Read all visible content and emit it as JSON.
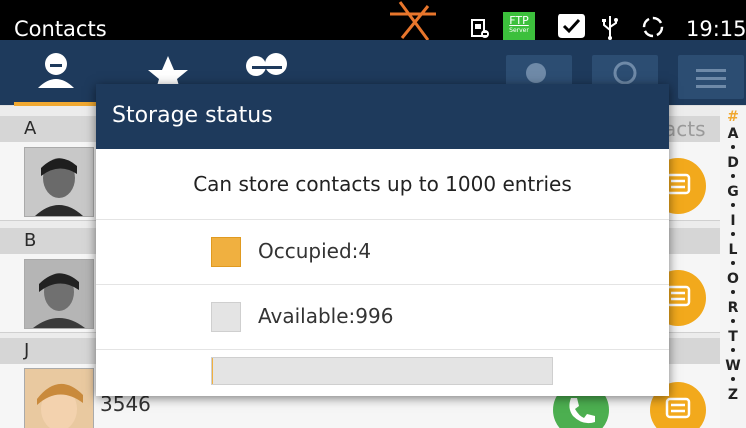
{
  "statusbar": {
    "app_title": "Contacts",
    "ftp_badge": "FTP",
    "ftp_sub": "Server",
    "time": "19:15"
  },
  "tabs": [
    {
      "name": "contacts-tab",
      "icon": "person-icon"
    },
    {
      "name": "favorites-tab",
      "icon": "star-icon"
    },
    {
      "name": "groups-tab",
      "icon": "group-icon"
    }
  ],
  "list": {
    "sections": [
      "A",
      "B",
      "J"
    ],
    "visible_number": "3546",
    "ghost_text": "acts"
  },
  "index_letters": [
    "#",
    "A",
    "D",
    "G",
    "I",
    "L",
    "O",
    "R",
    "T",
    "W",
    "Z"
  ],
  "dialog": {
    "title": "Storage status",
    "message": "Can store contacts up to 1000 entries",
    "occupied_label": "Occupied",
    "occupied_value": "4",
    "available_label": "Available",
    "available_value": "996",
    "capacity": 1000,
    "occupied_count": 4
  },
  "colors": {
    "header_blue": "#1e3a5c",
    "occupied": "#f0b040",
    "available": "#e4e4e4",
    "chat_orange": "#f2a91c",
    "call_green": "#4caf50"
  }
}
